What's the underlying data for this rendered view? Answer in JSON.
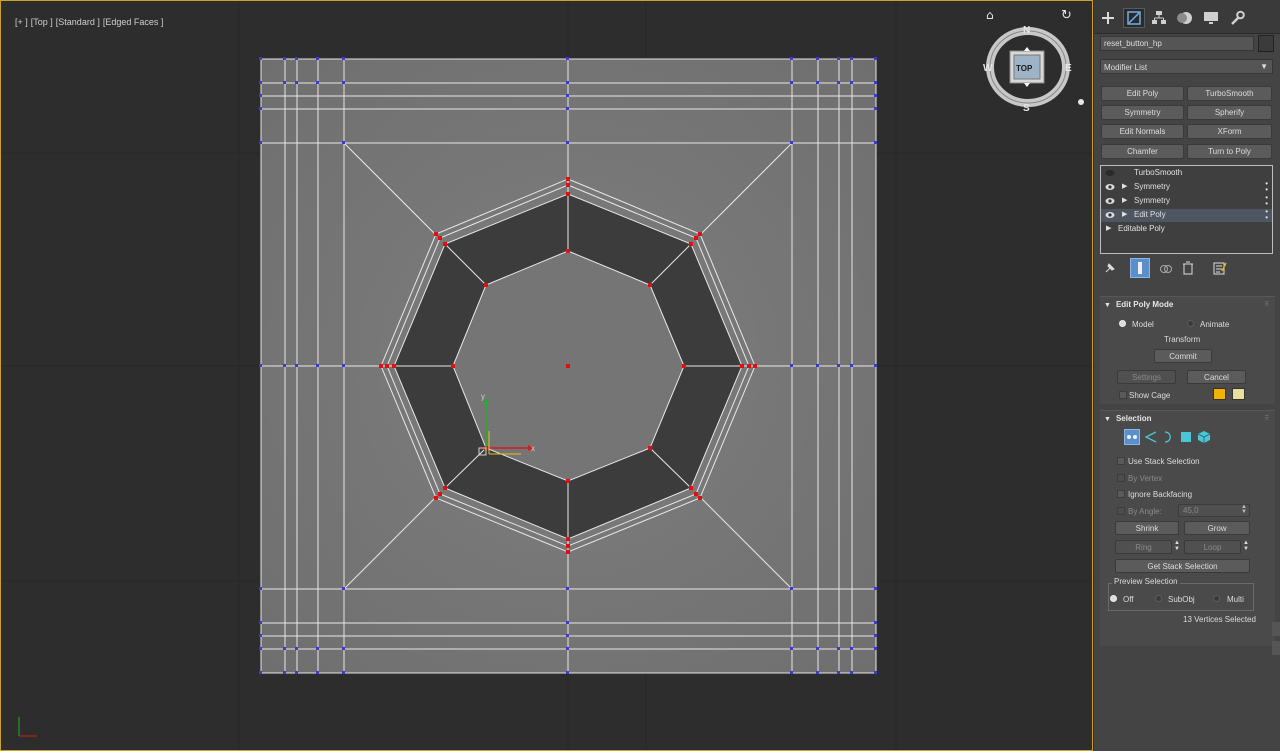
{
  "viewport": {
    "labels": [
      "[+ ]",
      "[Top ]",
      "[Standard ]",
      "[Edged Faces ]"
    ],
    "navcube": {
      "face": "TOP",
      "north": "N",
      "south": "S",
      "east": "E",
      "west": "W"
    },
    "gizmo": {
      "x_axis": "x",
      "y_axis": "y"
    },
    "colors": {
      "wire": "#e8e8e8",
      "selected_vertex": "#e01010",
      "vertex": "#3a3ad0",
      "plane": "#7c7c7c",
      "inner_ring": "#3c3c3c",
      "border": "#c9a227"
    }
  },
  "panel": {
    "tabs": [
      {
        "icon": "create-plus-icon"
      },
      {
        "icon": "modify-icon",
        "active": true
      },
      {
        "icon": "hierarchy-icon"
      },
      {
        "icon": "motion-icon"
      },
      {
        "icon": "display-icon"
      },
      {
        "icon": "utilities-wrench-icon"
      }
    ],
    "object_name": "reset_button_hp",
    "modifier_list": "Modifier List",
    "modifier_buttons": [
      "Edit Poly",
      "TurboSmooth",
      "Symmetry",
      "Spherify",
      "Edit Normals",
      "XForm",
      "Chamfer",
      "Turn to Poly"
    ],
    "stack": [
      {
        "label": "TurboSmooth",
        "eye": "off",
        "expand": false,
        "highlight": false
      },
      {
        "label": "Symmetry",
        "eye": "on",
        "expand": true,
        "highlight": false
      },
      {
        "label": "Symmetry",
        "eye": "on",
        "expand": true,
        "highlight": false
      },
      {
        "label": "Edit Poly",
        "eye": "on",
        "expand": true,
        "highlight": true
      },
      {
        "label": "Editable Poly",
        "eye": "none",
        "expand": true,
        "highlight": false
      }
    ],
    "edit_poly_mode": {
      "title": "Edit Poly Mode",
      "model": "Model",
      "animate": "Animate",
      "transform": "Transform",
      "commit": "Commit",
      "settings": "Settings",
      "cancel": "Cancel",
      "show_cage": "Show Cage",
      "cage_color_1": "#f0b400",
      "cage_color_2": "#e8e09a"
    },
    "selection": {
      "title": "Selection",
      "use_stack_selection": "Use Stack Selection",
      "by_vertex": "By Vertex",
      "ignore_backfacing": "Ignore Backfacing",
      "by_angle": "By Angle:",
      "angle_value": "45,0",
      "shrink": "Shrink",
      "grow": "Grow",
      "ring": "Ring",
      "loop": "Loop",
      "get_stack_selection": "Get Stack Selection",
      "preview_selection": "Preview Selection",
      "off": "Off",
      "subobj": "SubObj",
      "multi": "Multi",
      "status": "13 Vertices Selected"
    }
  }
}
